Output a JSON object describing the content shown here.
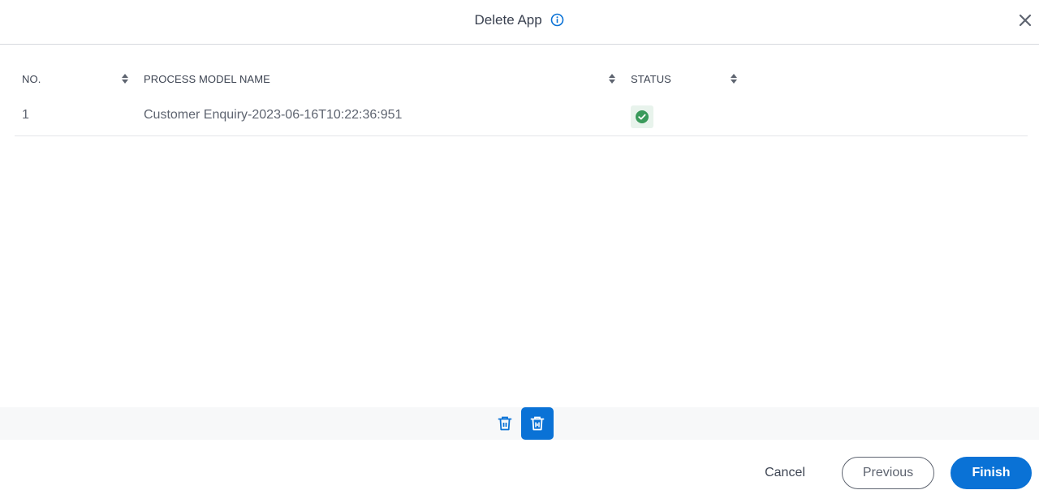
{
  "dialog": {
    "title": "Delete App",
    "info_icon": "info-circle-icon",
    "close_icon": "close-x-icon"
  },
  "table": {
    "columns": [
      {
        "label": "NO.",
        "sortable": true
      },
      {
        "label": "PROCESS MODEL NAME",
        "sortable": true
      },
      {
        "label": "STATUS",
        "sortable": true
      }
    ],
    "rows": [
      {
        "no": "1",
        "process_model_name": "Customer Enquiry-2023-06-16T10:22:36:951",
        "status": "success",
        "status_icon": "check-circle-icon"
      }
    ]
  },
  "toolbar": {
    "items": [
      {
        "name": "delete-icon",
        "active": false
      },
      {
        "name": "delete-all-icon",
        "active": true
      }
    ]
  },
  "footer": {
    "cancel_label": "Cancel",
    "previous_label": "Previous",
    "finish_label": "Finish"
  },
  "colors": {
    "accent": "#0a72d6",
    "success": "#3a9a5b",
    "success_bg": "#e8f3ec",
    "text": "#3d4452",
    "muted_text": "#5e6470"
  }
}
